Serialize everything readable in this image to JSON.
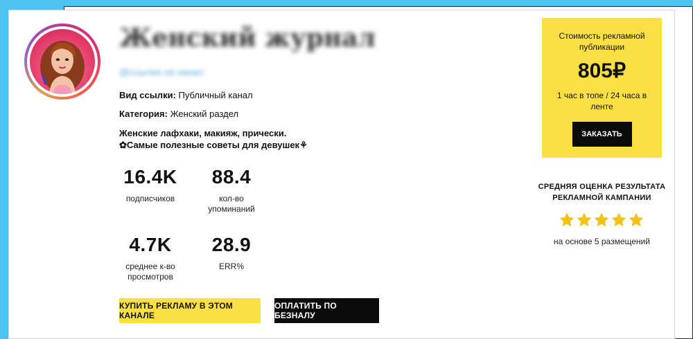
{
  "channel": {
    "title": "Женский журнал",
    "link": "@ссылка на канал",
    "link_type_label": "Вид ссылки:",
    "link_type_value": "Публичный канал",
    "category_label": "Категория:",
    "category_value": "Женский раздел",
    "description_line1": "Женские лафхаки, макияж, прически.",
    "description_line2": "✿Самые полезные советы для девушек⚘"
  },
  "stats": [
    {
      "value": "16.4K",
      "label": "подписчиков"
    },
    {
      "value": "88.4",
      "label": "кол-во упоминаний"
    },
    {
      "value": "4.7K",
      "label": "среднее к-во просмотров"
    },
    {
      "value": "28.9",
      "label": "ERR%"
    }
  ],
  "buttons": {
    "buy_ad": "КУПИТЬ РЕКЛАМУ В ЭТОМ КАНАЛЕ",
    "pay_cashless": "ОПЛАТИТЬ ПО БЕЗНАЛУ"
  },
  "price": {
    "caption": "Стоимость рекламной публикации",
    "value": "805₽",
    "note": "1 час в топе / 24 часа в ленте",
    "order_label": "ЗАКАЗАТЬ"
  },
  "rating": {
    "title": "СРЕДНЯЯ ОЦЕНКА РЕЗУЛЬТАТА РЕКЛАМНОЙ КАМПАНИИ",
    "stars": 5,
    "max_stars": 5,
    "note": "на основе 5 размещений",
    "star_color": "#f2c218"
  },
  "colors": {
    "accent_yellow": "#fce043",
    "background": "#4fc1f0",
    "button_black": "#0b0b0b"
  },
  "icons": {
    "avatar": "channel-avatar-illustration",
    "star": "star-icon"
  }
}
